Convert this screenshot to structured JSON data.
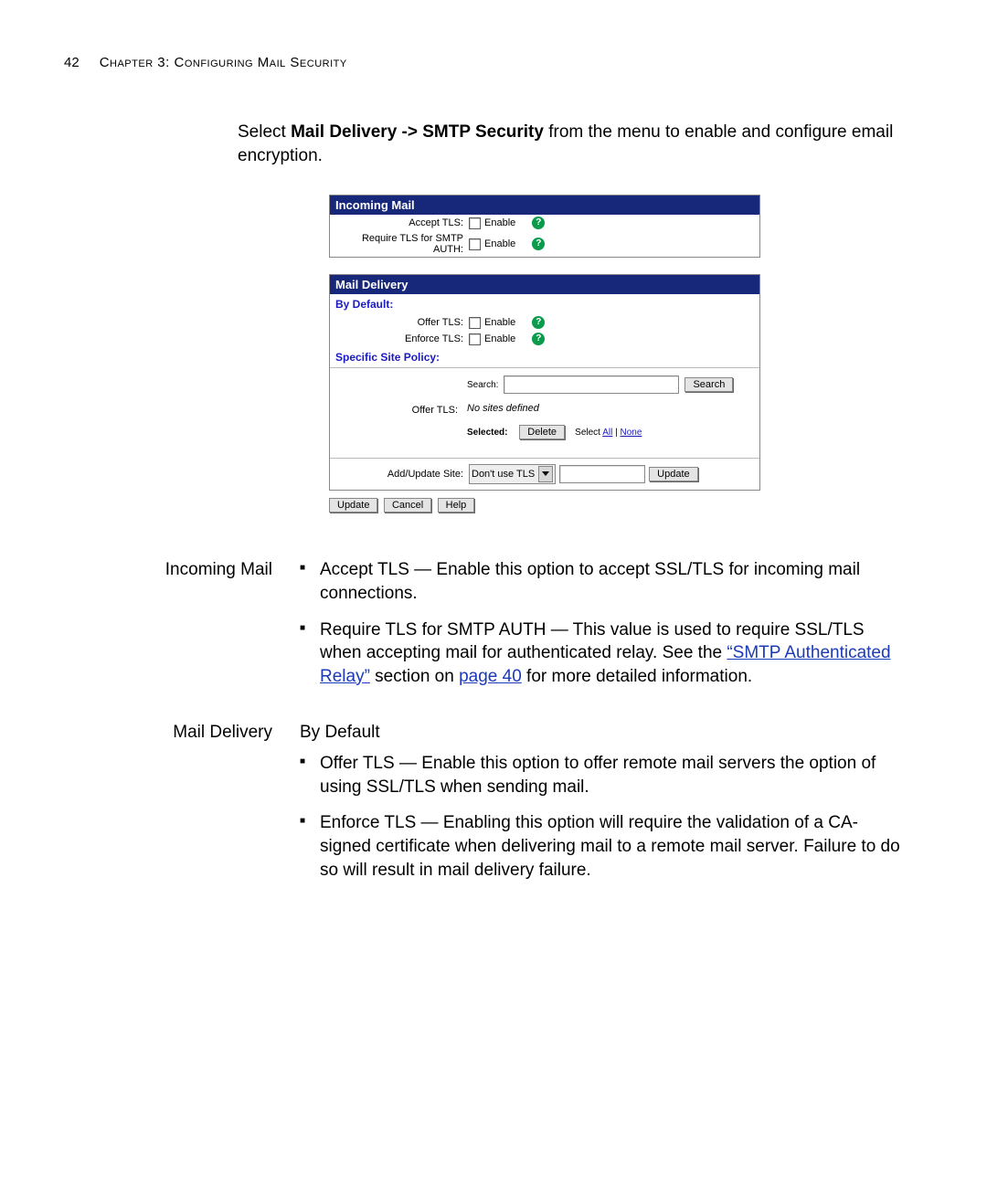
{
  "page": {
    "number": "42",
    "chapter": "Chapter 3: Configuring Mail Security"
  },
  "intro": {
    "pre": "Select ",
    "bold": "Mail Delivery -> SMTP Security",
    "post": " from the menu to enable and configure email encryption."
  },
  "panel": {
    "incoming_header": "Incoming Mail",
    "accept_label": "Accept TLS:",
    "require_label": "Require TLS for SMTP AUTH:",
    "enable_text": "Enable",
    "delivery_header": "Mail Delivery",
    "by_default": "By Default:",
    "offer_label": "Offer TLS:",
    "enforce_label": "Enforce TLS:",
    "site_policy": "Specific Site Policy:",
    "search_label": "Search:",
    "search_btn": "Search",
    "no_sites": "No sites defined",
    "selected_label": "Selected:",
    "delete_btn": "Delete",
    "select_prefix": "Select ",
    "select_all": "All",
    "select_sep": " | ",
    "select_none": "None",
    "addupdate_label": "Add/Update Site:",
    "dontuse": "Don't use TLS",
    "update_btn": "Update",
    "footer_update": "Update",
    "footer_cancel": "Cancel",
    "footer_help": "Help"
  },
  "desc": {
    "incoming_heading": "Incoming Mail",
    "accept_bullet": "Accept TLS — Enable this option to accept SSL/TLS for incoming mail connections.",
    "require_pre": "Require TLS for SMTP AUTH — This value is used to require SSL/TLS when accepting mail for authenticated relay. See the ",
    "require_link": "“SMTP Authenticated Relay”",
    "require_mid": " section on ",
    "require_page": "page 40",
    "require_post": " for more detailed information.",
    "delivery_heading": "Mail Delivery",
    "by_default_sub": "By Default",
    "offer_bullet": "Offer TLS — Enable this option to offer remote mail servers the option of using SSL/TLS when sending mail.",
    "enforce_bullet": "Enforce TLS — Enabling this option will require the validation of a CA-signed certificate when delivering mail to a remote mail server. Failure to do so will result in mail delivery failure."
  }
}
